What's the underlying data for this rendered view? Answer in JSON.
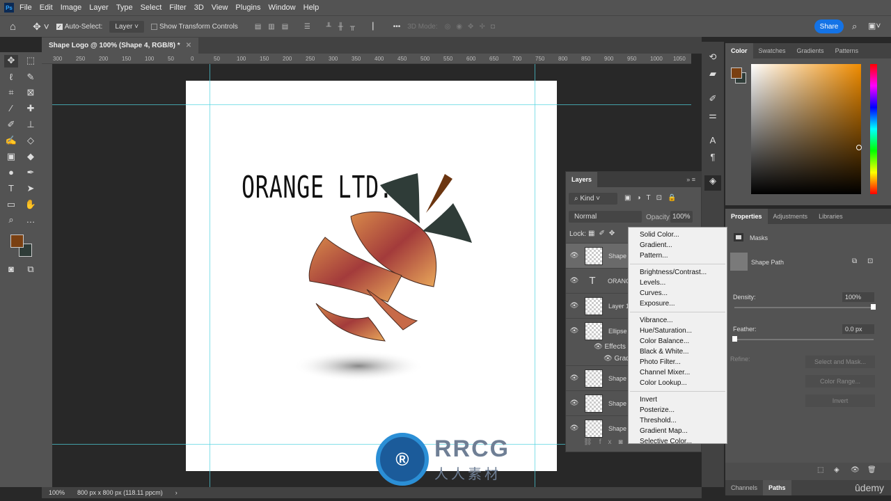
{
  "app": {
    "logo": "Ps",
    "menu": [
      "File",
      "Edit",
      "Image",
      "Layer",
      "Type",
      "Select",
      "Filter",
      "3D",
      "View",
      "Plugins",
      "Window",
      "Help"
    ]
  },
  "options": {
    "auto_select_label": "Auto-Select:",
    "auto_select_checked": true,
    "auto_select_value": "Layer",
    "show_transform_label": "Show Transform Controls",
    "mode_3d": "3D Mode:",
    "share": "Share"
  },
  "document": {
    "tab_title": "Shape Logo @ 100% (Shape 4, RGB/8) *",
    "logo_text": "ORANGE LTD."
  },
  "ruler": {
    "h_ticks": [
      "300",
      "250",
      "200",
      "150",
      "100",
      "50",
      "0",
      "50",
      "100",
      "150",
      "200",
      "250",
      "300",
      "350",
      "400",
      "450",
      "500",
      "550",
      "600",
      "650",
      "700",
      "750",
      "800",
      "850",
      "900",
      "950",
      "1000",
      "1050"
    ]
  },
  "status": {
    "zoom": "100%",
    "doc_info": "800 px x 800 px (118.11 ppcm)"
  },
  "colors": {
    "foreground": "#7a4012",
    "background": "#2f3c38",
    "accent": "#1473e6"
  },
  "color_panel": {
    "tabs": [
      "Color",
      "Swatches",
      "Gradients",
      "Patterns"
    ]
  },
  "properties": {
    "tabs": [
      "Properties",
      "Adjustments",
      "Libraries"
    ],
    "section": "Masks",
    "item": "Shape Path",
    "density_label": "Density:",
    "density": "100%",
    "density_fraction": 1.0,
    "feather_label": "Feather:",
    "feather": "0.0 px",
    "feather_fraction": 0.0,
    "refine_label": "Refine:",
    "buttons": [
      "Select and Mask...",
      "Color Range...",
      "Invert"
    ]
  },
  "bottom_tabs": [
    "Channels",
    "Paths"
  ],
  "watermark": "ûdemy",
  "layers": {
    "title": "Layers",
    "filter": "Kind",
    "blend": "Normal",
    "opacity_label": "Opacity:",
    "opacity": "100%",
    "lock_label": "Lock:",
    "rows": [
      {
        "name": "Shape"
      },
      {
        "name": "ORANG"
      },
      {
        "name": "Layer 1"
      },
      {
        "name": "Ellipse"
      },
      {
        "name": "Effects"
      },
      {
        "name": "Grad"
      },
      {
        "name": "Shape"
      },
      {
        "name": "Shape"
      },
      {
        "name": "Shape"
      }
    ]
  },
  "context_menu": {
    "groups": [
      [
        "Solid Color...",
        "Gradient...",
        "Pattern..."
      ],
      [
        "Brightness/Contrast...",
        "Levels...",
        "Curves...",
        "Exposure..."
      ],
      [
        "Vibrance...",
        "Hue/Saturation...",
        "Color Balance...",
        "Black & White...",
        "Photo Filter...",
        "Channel Mixer...",
        "Color Lookup..."
      ],
      [
        "Invert",
        "Posterize...",
        "Threshold...",
        "Gradient Map...",
        "Selective Color..."
      ]
    ]
  },
  "overlay_watermark": {
    "logo": "RRCG",
    "sub": "人人素材"
  }
}
